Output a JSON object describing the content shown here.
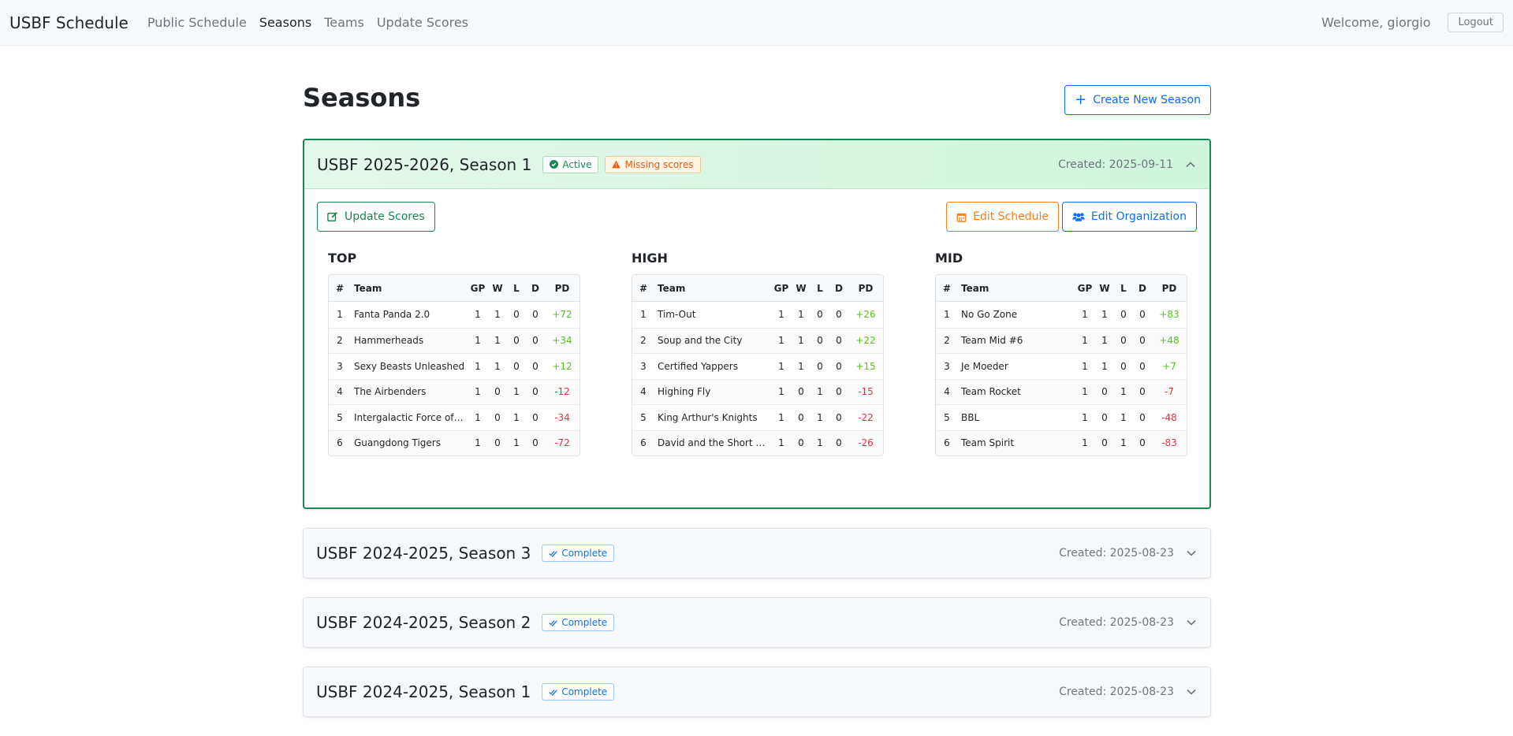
{
  "nav": {
    "brand": "USBF Schedule",
    "links": [
      "Public Schedule",
      "Seasons",
      "Teams",
      "Update Scores"
    ],
    "active": "Seasons",
    "welcome": "Welcome, giorgio",
    "logout": "Logout"
  },
  "page": {
    "title": "Seasons",
    "create_button": "Create New Season"
  },
  "active_season": {
    "name": "USBF 2025-2026, Season 1",
    "badges": {
      "active": "Active",
      "missing": "Missing scores"
    },
    "created": "Created: 2025-09-11",
    "actions": {
      "update_scores": "Update Scores",
      "edit_schedule": "Edit Schedule",
      "edit_organization": "Edit Organization"
    },
    "columns": [
      "#",
      "Team",
      "GP",
      "W",
      "L",
      "D",
      "PD"
    ],
    "divisions": [
      {
        "name": "TOP",
        "rows": [
          [
            "1",
            "Fanta Panda 2.0",
            "1",
            "1",
            "0",
            "0",
            "+72"
          ],
          [
            "2",
            "Hammerheads",
            "1",
            "1",
            "0",
            "0",
            "+34"
          ],
          [
            "3",
            "Sexy Beasts Unleashed",
            "1",
            "1",
            "0",
            "0",
            "+12"
          ],
          [
            "4",
            "The Airbenders",
            "1",
            "0",
            "1",
            "0",
            "-12"
          ],
          [
            "5",
            "Intergalactic Force of…",
            "1",
            "0",
            "1",
            "0",
            "-34"
          ],
          [
            "6",
            "Guangdong Tigers",
            "1",
            "0",
            "1",
            "0",
            "-72"
          ]
        ]
      },
      {
        "name": "HIGH",
        "rows": [
          [
            "1",
            "Tim-Out",
            "1",
            "1",
            "0",
            "0",
            "+26"
          ],
          [
            "2",
            "Soup and the City",
            "1",
            "1",
            "0",
            "0",
            "+22"
          ],
          [
            "3",
            "Certified Yappers",
            "1",
            "1",
            "0",
            "0",
            "+15"
          ],
          [
            "4",
            "Highing Fly",
            "1",
            "0",
            "1",
            "0",
            "-15"
          ],
          [
            "5",
            "King Arthur's Knights",
            "1",
            "0",
            "1",
            "0",
            "-22"
          ],
          [
            "6",
            "David and the Short …",
            "1",
            "0",
            "1",
            "0",
            "-26"
          ]
        ]
      },
      {
        "name": "MID",
        "rows": [
          [
            "1",
            "No Go Zone",
            "1",
            "1",
            "0",
            "0",
            "+83"
          ],
          [
            "2",
            "Team Mid #6",
            "1",
            "1",
            "0",
            "0",
            "+48"
          ],
          [
            "3",
            "Je Moeder",
            "1",
            "1",
            "0",
            "0",
            "+7"
          ],
          [
            "4",
            "Team Rocket",
            "1",
            "0",
            "1",
            "0",
            "-7"
          ],
          [
            "5",
            "BBL",
            "1",
            "0",
            "1",
            "0",
            "-48"
          ],
          [
            "6",
            "Team Spirit",
            "1",
            "0",
            "1",
            "0",
            "-83"
          ]
        ]
      }
    ]
  },
  "other_seasons": [
    {
      "name": "USBF 2024-2025, Season 3",
      "badge": "Complete",
      "created": "Created: 2025-08-23"
    },
    {
      "name": "USBF 2024-2025, Season 2",
      "badge": "Complete",
      "created": "Created: 2025-08-23"
    },
    {
      "name": "USBF 2024-2025, Season 1",
      "badge": "Complete",
      "created": "Created: 2025-08-23"
    }
  ],
  "icons": {
    "create": "plus-icon",
    "active": "check-circle-icon",
    "missing": "warning-triangle-icon",
    "complete": "double-check-icon",
    "update": "edit-icon",
    "schedule": "calendar-icon",
    "org": "users-icon",
    "collapse": "chevron-up-icon",
    "expand": "chevron-down-icon"
  },
  "colors": {
    "positive": "#52c41a",
    "negative": "#dc3545",
    "success": "#198754",
    "primary": "#0d6efd",
    "warning": "#fd7e14"
  }
}
